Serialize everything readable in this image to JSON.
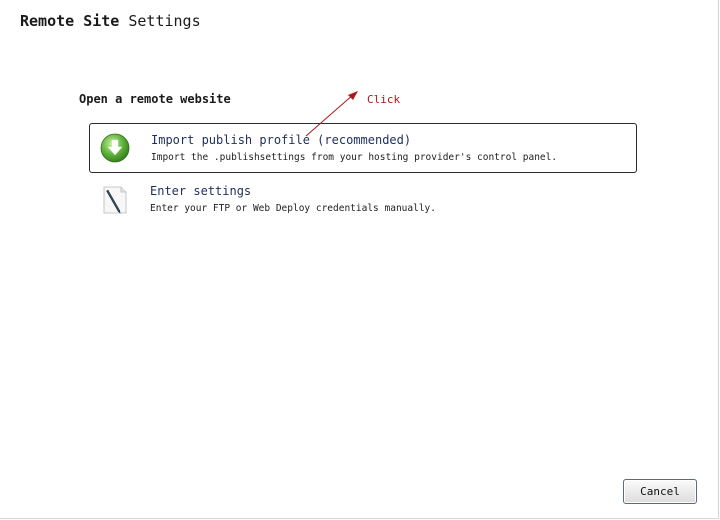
{
  "dialog": {
    "title_bold": "Remote Site",
    "title_normal": "Settings"
  },
  "section": {
    "heading": "Open a remote website"
  },
  "options": [
    {
      "title": "Import publish profile (recommended)",
      "description": "Import the .publishsettings from your hosting provider's control panel.",
      "icon": "download-arrow-icon",
      "selected": true
    },
    {
      "title": "Enter settings",
      "description": "Enter your FTP or Web Deploy credentials manually.",
      "icon": "document-pen-icon",
      "selected": false
    }
  ],
  "annotation": {
    "label": "Click",
    "color": "#b01818"
  },
  "footer": {
    "cancel_label": "Cancel"
  },
  "colors": {
    "option_title": "#1f2f5a",
    "icon_green": "#4aa02c"
  }
}
